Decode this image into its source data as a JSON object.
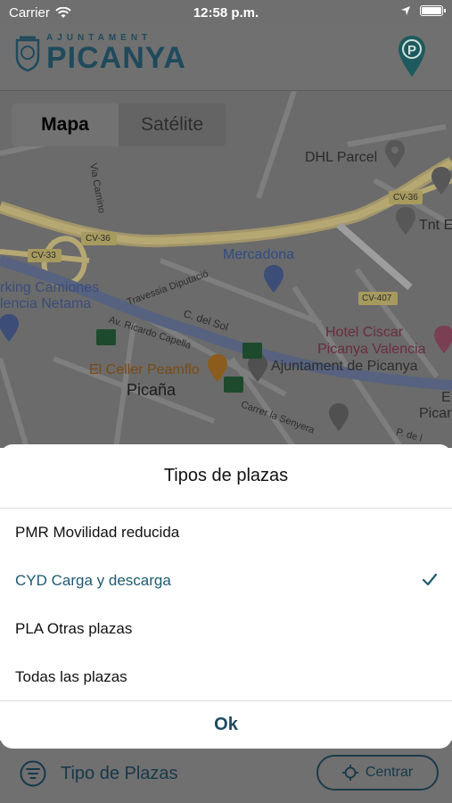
{
  "status_bar": {
    "carrier": "Carrier",
    "time": "12:58 p.m."
  },
  "header": {
    "logo_top": "AJUNTAMENT",
    "logo_main": "PICANYA"
  },
  "map": {
    "view_toggle": {
      "map": "Mapa",
      "satellite": "Satélite"
    },
    "labels": {
      "dhl": "DHL Parcel",
      "tnt": "Tnt E",
      "mercadona": "Mercadona",
      "parking": "rking Camiones",
      "parking2": "lencia Netama",
      "hotel": "Hotel Ciscar",
      "hotel2": "Picanya Valencia",
      "celler": "El Celler Peamflo",
      "ajuntament": "Ajuntament de Picanya",
      "picana": "Picaña",
      "edge1": "E",
      "edge2": "Picar",
      "cv36": "CV-36",
      "cv36b": "CV-36",
      "cv33": "CV-33",
      "cv407": "CV-407",
      "via_camino": "Via Camino",
      "travessia": "Travessia Diputació",
      "c_sol": "C. del Sol",
      "ricardo": "Av. Ricardo Capella",
      "senyera": "Carrer la Senyera",
      "p_de": "P. de l"
    }
  },
  "sheet": {
    "title": "Tipos de plazas",
    "options": [
      {
        "label": "PMR Movilidad reducida",
        "selected": false
      },
      {
        "label": "CYD Carga y descarga",
        "selected": true
      },
      {
        "label": "PLA Otras plazas",
        "selected": false
      },
      {
        "label": "Todas las plazas",
        "selected": false
      }
    ],
    "ok": "Ok"
  },
  "bottom_bar": {
    "filter_label": "Tipo de Plazas",
    "center_button": "Centrar"
  },
  "colors": {
    "accent": "#1e5a72",
    "road_yellow": "#b8a86a",
    "river": "#5a6a8a",
    "pin_green": "#2e7d4f"
  }
}
